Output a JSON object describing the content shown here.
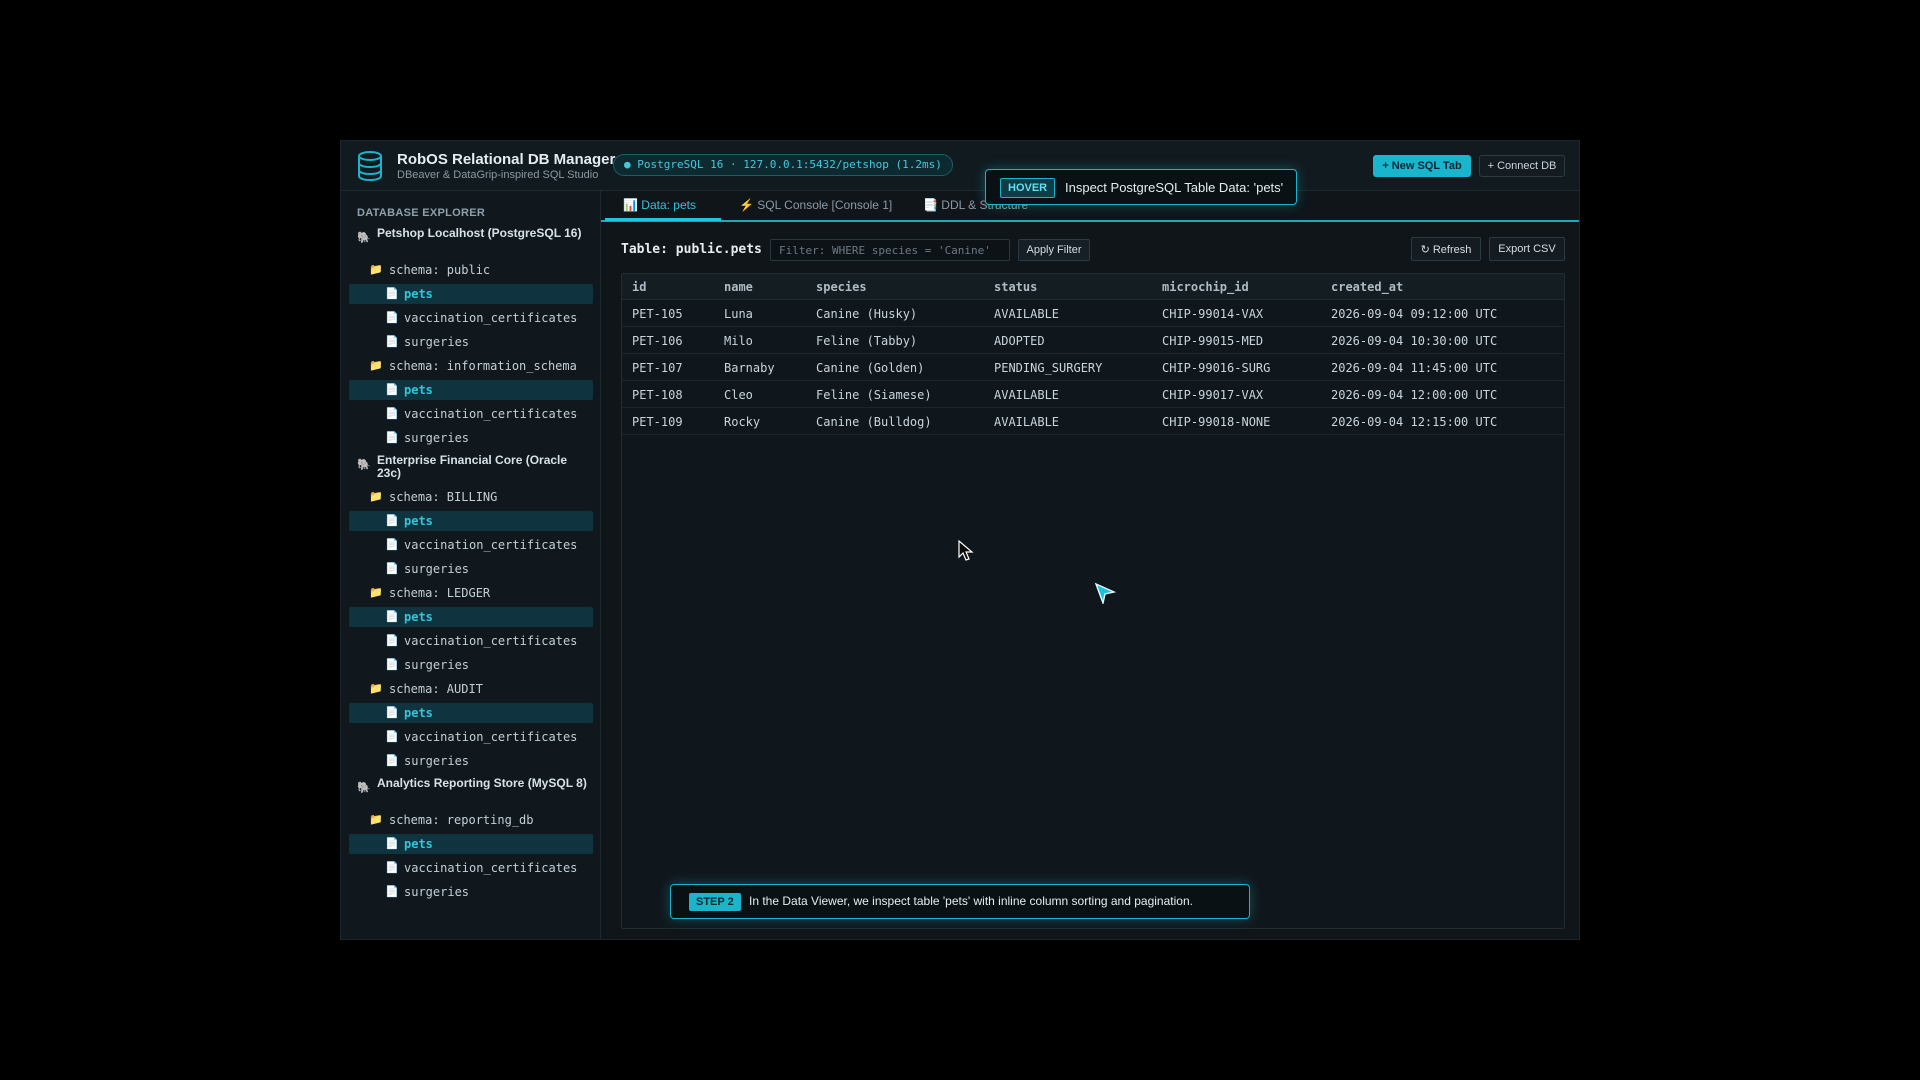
{
  "header": {
    "title": "RobOS Relational DB Manager",
    "subtitle": "DBeaver & DataGrip-inspired SQL Studio",
    "connection_badge": "● PostgreSQL 16 · 127.0.0.1:5432/petshop (1.2ms)",
    "new_sql_tab": "+ New SQL Tab",
    "connect_db": "+ Connect DB"
  },
  "sidebar": {
    "title": "DATABASE EXPLORER",
    "connections": [
      {
        "name": "Petshop Localhost (PostgreSQL 16)",
        "schemas": [
          {
            "name": "schema: public",
            "tables": [
              "pets",
              "vaccination_certificates",
              "surgeries"
            ]
          },
          {
            "name": "schema: information_schema",
            "tables": [
              "pets",
              "vaccination_certificates",
              "surgeries"
            ]
          }
        ]
      },
      {
        "name": "Enterprise Financial Core (Oracle 23c)",
        "schemas": [
          {
            "name": "schema: BILLING",
            "tables": [
              "pets",
              "vaccination_certificates",
              "surgeries"
            ]
          },
          {
            "name": "schema: LEDGER",
            "tables": [
              "pets",
              "vaccination_certificates",
              "surgeries"
            ]
          },
          {
            "name": "schema: AUDIT",
            "tables": [
              "pets",
              "vaccination_certificates",
              "surgeries"
            ]
          }
        ]
      },
      {
        "name": "Analytics Reporting Store (MySQL 8)",
        "schemas": [
          {
            "name": "schema: reporting_db",
            "tables": [
              "pets",
              "vaccination_certificates",
              "surgeries"
            ]
          }
        ]
      }
    ]
  },
  "tabs": {
    "data": "Data: pets",
    "console": "SQL Console [Console 1]",
    "ddl": "DDL & Structure"
  },
  "toolbar": {
    "table_label": "Table: public.pets",
    "filter_placeholder": "Filter: WHERE species = 'Canine'",
    "apply_filter": "Apply Filter",
    "refresh": "↻ Refresh",
    "export_csv": "Export CSV"
  },
  "grid": {
    "columns": [
      "id",
      "name",
      "species",
      "status",
      "microchip_id",
      "created_at"
    ],
    "rows": [
      [
        "PET-105",
        "Luna",
        "Canine (Husky)",
        "AVAILABLE",
        "CHIP-99014-VAX",
        "2026-09-04 09:12:00 UTC"
      ],
      [
        "PET-106",
        "Milo",
        "Feline (Tabby)",
        "ADOPTED",
        "CHIP-99015-MED",
        "2026-09-04 10:30:00 UTC"
      ],
      [
        "PET-107",
        "Barnaby",
        "Canine (Golden)",
        "PENDING_SURGERY",
        "CHIP-99016-SURG",
        "2026-09-04 11:45:00 UTC"
      ],
      [
        "PET-108",
        "Cleo",
        "Feline (Siamese)",
        "AVAILABLE",
        "CHIP-99017-VAX",
        "2026-09-04 12:00:00 UTC"
      ],
      [
        "PET-109",
        "Rocky",
        "Canine (Bulldog)",
        "AVAILABLE",
        "CHIP-99018-NONE",
        "2026-09-04 12:15:00 UTC"
      ]
    ]
  },
  "hover_tooltip": {
    "badge": "HOVER",
    "text": "Inspect PostgreSQL Table Data: 'pets'"
  },
  "step_tooltip": {
    "badge": "STEP 2",
    "text": "In the Data Viewer, we inspect table 'pets' with inline column sorting and pagination."
  },
  "icons": {
    "logo": "database-icon",
    "connection": "elephant-icon",
    "schema": "folder-icon",
    "table": "file-icon",
    "data_tab": "bar-chart-icon",
    "console_tab": "lightning-icon",
    "ddl_tab": "document-icon"
  },
  "colors": {
    "accent": "#19b5cc",
    "background": "#0f1519",
    "active_item": "#0f3440"
  }
}
